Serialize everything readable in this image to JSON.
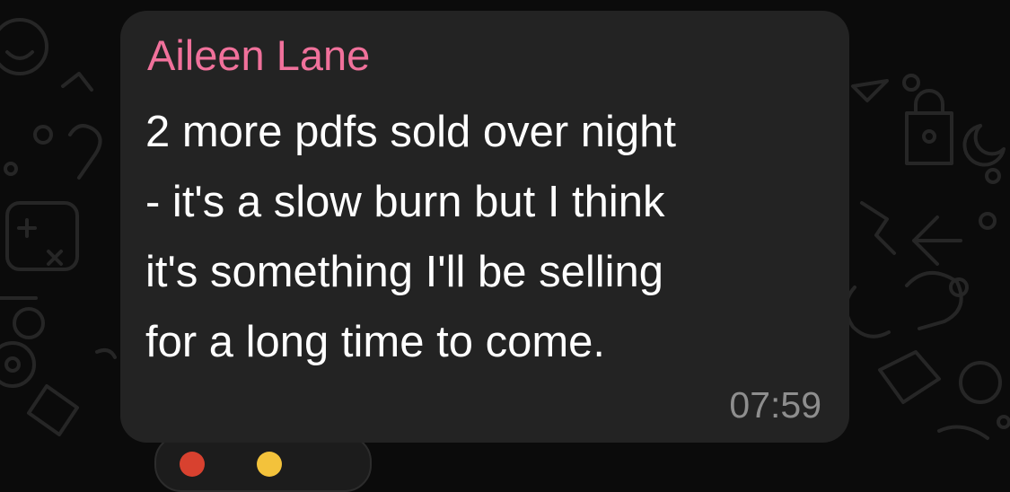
{
  "message": {
    "sender": "Aileen Lane",
    "lines": [
      "2 more pdfs sold over night",
      "- it's a slow burn but I think",
      "it's something I'll be selling",
      "for a long time to come."
    ],
    "time": "07:59"
  },
  "colors": {
    "background": "#0b0b0b",
    "wallpaper_doodle": "#262626",
    "bubble": "#232323",
    "sender_name": "#f0719b",
    "message_text": "#ffffff",
    "timestamp": "#8e8e8e",
    "reaction_red": "#d8412f",
    "reaction_yellow": "#f3c23b"
  },
  "icons": [
    "chat-wallpaper-doodles",
    "reaction-emoji-icon"
  ]
}
